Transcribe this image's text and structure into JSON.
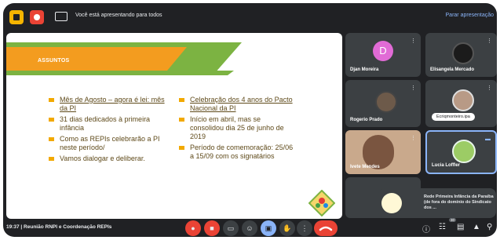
{
  "topbar": {
    "presenting_text": "Você está apresentando para todos",
    "stop_presenting": "Parar apresentação"
  },
  "slide": {
    "title": "ASSUNTOS",
    "left_bullets": [
      "Mês de Agosto – agora é lei: mês da PI",
      "31 dias dedicados à primeira infância",
      "Como as REPIs celebrarão a PI neste período/",
      "Vamos dialogar e deliberar."
    ],
    "right_bullets": [
      "Celebração dos 4 anos do Pacto Nacional da PI",
      "Início em abril, mas se consolidou dia 25 de junho de 2019",
      "Período de comemoração: 25/06 a 15/09 com os signatários"
    ],
    "colors": {
      "green": "#7cb342",
      "orange": "#f39c1f",
      "bullet": "#f2a900"
    }
  },
  "participants": [
    {
      "name": "Djan Moreira",
      "initial": "D",
      "avatar_color": "#e16bd6"
    },
    {
      "name": "Elisangela Mercado"
    },
    {
      "name": "Rogerio Prado"
    },
    {
      "name": "Ecriqmonteiro.ipa"
    },
    {
      "name": "Ivete Mendes"
    },
    {
      "name": "Lucia Loffler"
    }
  ],
  "notification": {
    "text": "Rede Primeira Infância da Paraíba (de fora do domínio do Sindicato dos ..."
  },
  "bottombar": {
    "time_meeting": "19:37 | Reunião RNPI e Coordenação REPIs",
    "badge": "30"
  }
}
